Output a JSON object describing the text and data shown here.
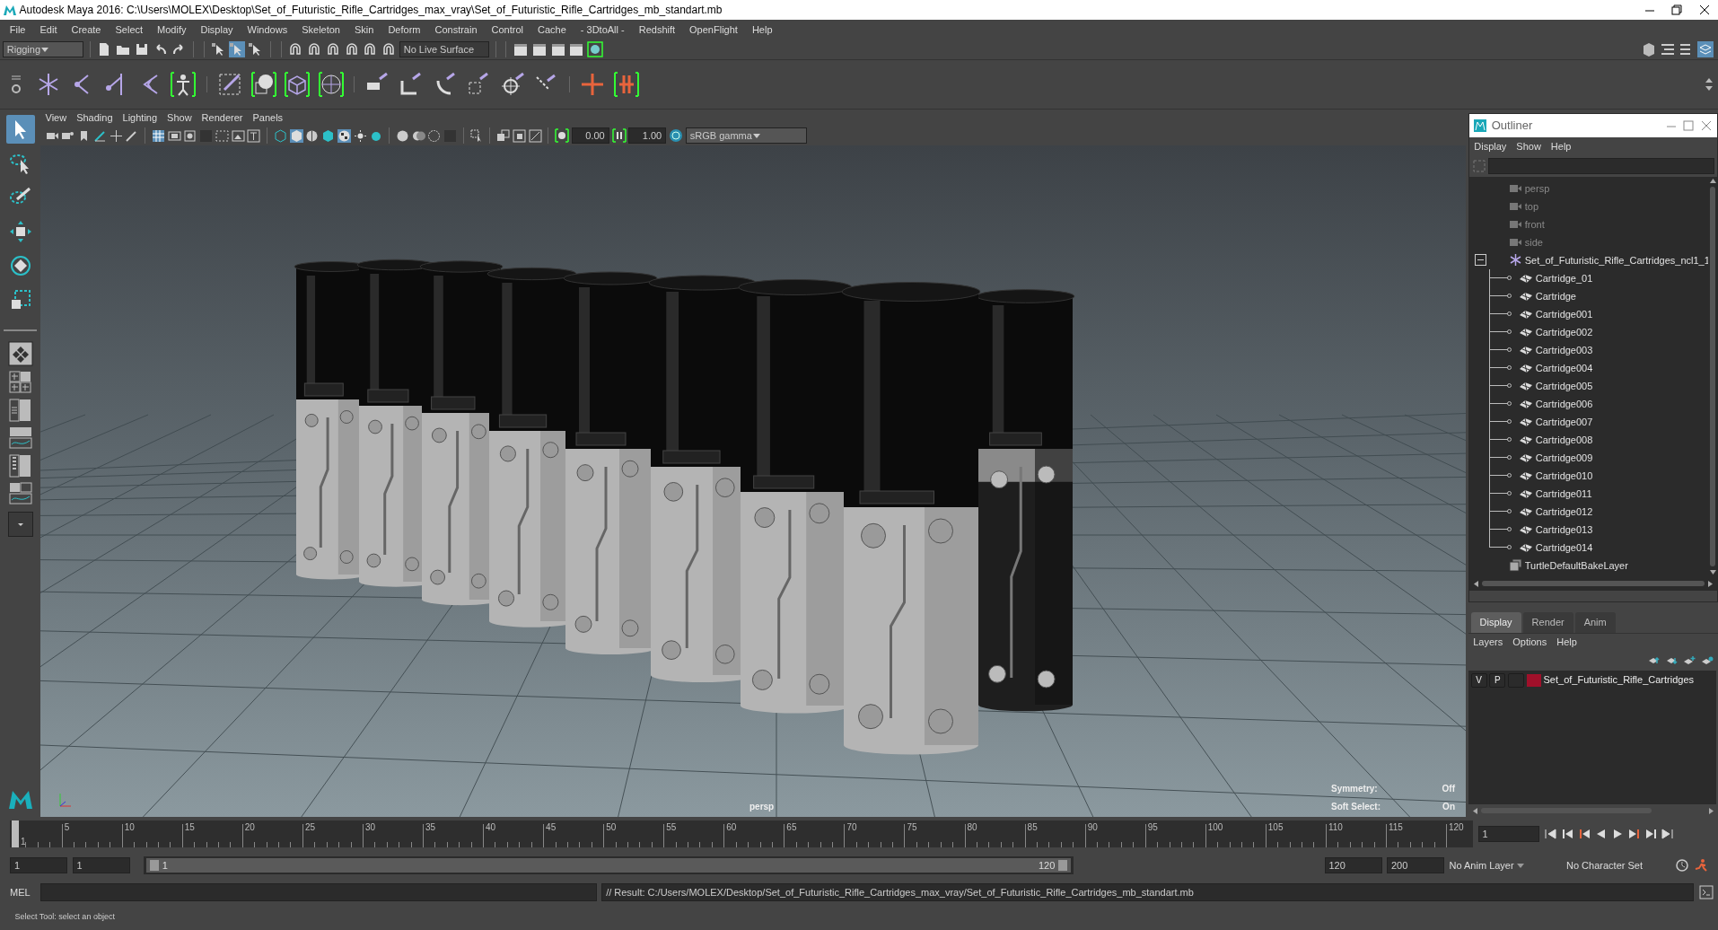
{
  "window": {
    "title": "Autodesk Maya 2016: C:\\Users\\MOLEX\\Desktop\\Set_of_Futuristic_Rifle_Cartridges_max_vray\\Set_of_Futuristic_Rifle_Cartridges_mb_standart.mb"
  },
  "menu_bar": [
    "File",
    "Edit",
    "Create",
    "Select",
    "Modify",
    "Display",
    "Windows",
    "Skeleton",
    "Skin",
    "Deform",
    "Constrain",
    "Control",
    "Cache",
    "- 3DtoAll -",
    "Redshift",
    "OpenFlight",
    "Help"
  ],
  "shelf": {
    "menu_set": "Rigging",
    "live_surface": "No Live Surface"
  },
  "toolbox": {
    "tools": [
      {
        "selected": true
      },
      {
        "selected": false
      },
      {
        "selected": false
      },
      {
        "selected": false
      },
      {
        "selected": false
      },
      {
        "selected": false
      }
    ]
  },
  "viewport": {
    "menu": [
      "View",
      "Shading",
      "Lighting",
      "Show",
      "Renderer",
      "Panels"
    ],
    "exposure": "0.00",
    "gamma": "1.00",
    "color_space": "sRGB gamma",
    "camera": "persp",
    "hud": [
      {
        "label": "Symmetry:",
        "value": "Off"
      },
      {
        "label": "Soft Select:",
        "value": "On"
      }
    ]
  },
  "outliner": {
    "title": "Outliner",
    "menu": [
      "Display",
      "Show",
      "Help"
    ],
    "items": [
      {
        "label": "persp",
        "kind": "camera"
      },
      {
        "label": "top",
        "kind": "camera"
      },
      {
        "label": "front",
        "kind": "camera"
      },
      {
        "label": "side",
        "kind": "camera"
      },
      {
        "label": "Set_of_Futuristic_Rifle_Cartridges_ncl1_1",
        "kind": "group",
        "expanded": true,
        "children": [
          {
            "label": "Cartridge_01",
            "kind": "mesh"
          },
          {
            "label": "Cartridge",
            "kind": "mesh"
          },
          {
            "label": "Cartridge001",
            "kind": "mesh"
          },
          {
            "label": "Cartridge002",
            "kind": "mesh"
          },
          {
            "label": "Cartridge003",
            "kind": "mesh"
          },
          {
            "label": "Cartridge004",
            "kind": "mesh"
          },
          {
            "label": "Cartridge005",
            "kind": "mesh"
          },
          {
            "label": "Cartridge006",
            "kind": "mesh"
          },
          {
            "label": "Cartridge007",
            "kind": "mesh"
          },
          {
            "label": "Cartridge008",
            "kind": "mesh"
          },
          {
            "label": "Cartridge009",
            "kind": "mesh"
          },
          {
            "label": "Cartridge010",
            "kind": "mesh"
          },
          {
            "label": "Cartridge011",
            "kind": "mesh"
          },
          {
            "label": "Cartridge012",
            "kind": "mesh"
          },
          {
            "label": "Cartridge013",
            "kind": "mesh"
          },
          {
            "label": "Cartridge014",
            "kind": "mesh"
          }
        ]
      },
      {
        "label": "TurtleDefaultBakeLayer",
        "kind": "layer"
      }
    ]
  },
  "layer_editor": {
    "tabs": [
      {
        "label": "Display",
        "selected": true
      },
      {
        "label": "Render",
        "selected": false
      },
      {
        "label": "Anim",
        "selected": false
      }
    ],
    "menu": [
      "Layers",
      "Options",
      "Help"
    ],
    "rows": [
      {
        "visible": "V",
        "playback": "P",
        "color": "#a0102a",
        "name": "Set_of_Futuristic_Rifle_Cartridges"
      }
    ]
  },
  "timeline": {
    "start": "1",
    "ticks": [
      "5",
      "10",
      "15",
      "20",
      "25",
      "30",
      "35",
      "40",
      "45",
      "50",
      "55",
      "60",
      "65",
      "70",
      "75",
      "80",
      "85",
      "90",
      "95",
      "100",
      "105",
      "110",
      "115",
      "120"
    ],
    "current_frame": "1",
    "level": 0
  },
  "range": {
    "start": "1",
    "playback_start": "1",
    "slider_start": "1",
    "slider_end": "120",
    "playback_end": "120",
    "end": "200",
    "anim_layer": "No Anim Layer",
    "character_set": "No Character Set",
    "level": 1
  },
  "command_line": {
    "language": "MEL",
    "result": "// Result: C:/Users/MOLEX/Desktop/Set_of_Futuristic_Rifle_Cartridges_max_vray/Set_of_Futuristic_Rifle_Cartridges_mb_standart.mb"
  },
  "help_line": "Select Tool: select an object"
}
